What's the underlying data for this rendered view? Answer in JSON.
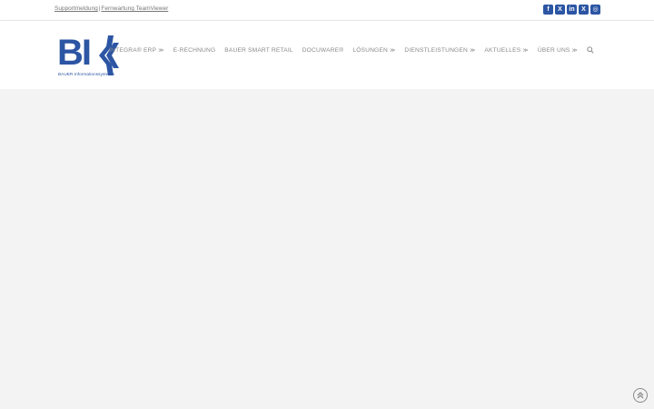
{
  "topbar": {
    "links": [
      "Supportmeldung",
      "Fernwartung TeamViewer"
    ],
    "separator": "|"
  },
  "social": {
    "icons": [
      "facebook-icon",
      "x-icon",
      "linkedin-icon",
      "xing-icon",
      "instagram-icon"
    ],
    "glyphs": [
      "f",
      "X",
      "in",
      "X",
      "◎"
    ],
    "color": "#2c55a3"
  },
  "logo": {
    "text": "BI",
    "subtitle": "BAUER Informationssysteme",
    "color": "#2c55a3"
  },
  "nav": {
    "items": [
      {
        "label": "INTEGRA® ERP",
        "dropdown": true
      },
      {
        "label": "E-RECHNUNG",
        "dropdown": false
      },
      {
        "label": "BAUER SMART RETAIL",
        "dropdown": false
      },
      {
        "label": "DOCUWARE®",
        "dropdown": false
      },
      {
        "label": "LÖSUNGEN",
        "dropdown": true
      },
      {
        "label": "DIENSTLEISTUNGEN",
        "dropdown": true
      },
      {
        "label": "AKTUELLES",
        "dropdown": true
      },
      {
        "label": "ÜBER UNS",
        "dropdown": true
      }
    ],
    "chevron": "≫"
  },
  "colors": {
    "accent": "#2c55a3",
    "nav_text": "#8a8a8a",
    "background": "#f3f3f3"
  }
}
